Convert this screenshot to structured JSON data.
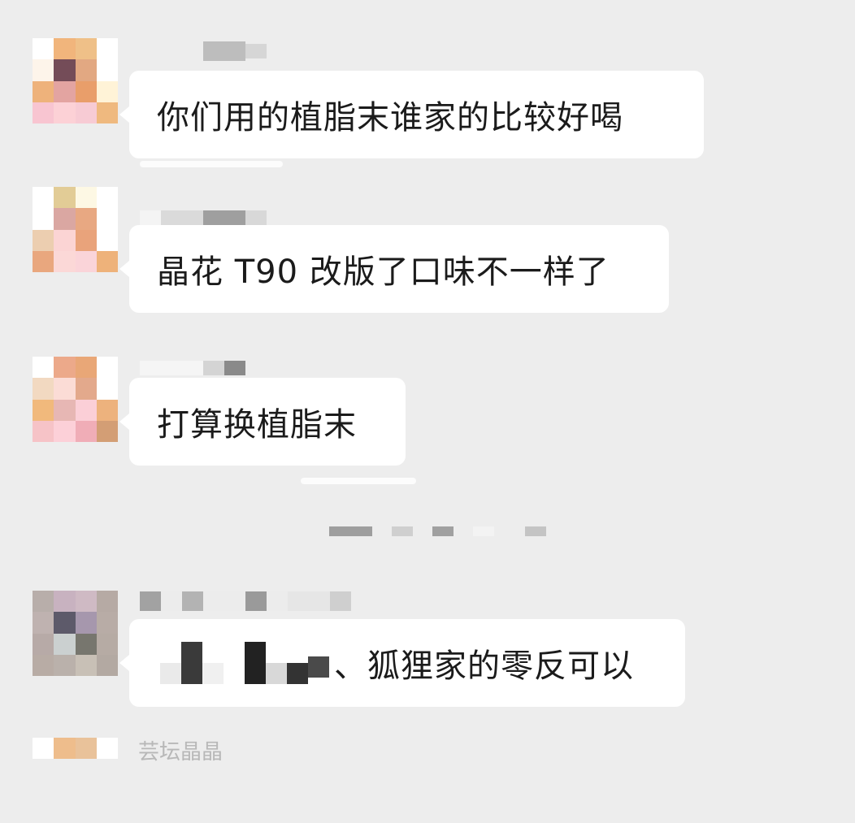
{
  "messages": [
    {
      "text": "你们用的植脂末谁家的比较好喝"
    },
    {
      "text": "晶花 T90 改版了口味不一样了"
    },
    {
      "text": "打算换植脂末"
    },
    {
      "text": "、狐狸家的零反可以"
    }
  ],
  "partial_name": "芸坛晶晶",
  "colors": {
    "background": "#ededed",
    "bubble": "#ffffff",
    "text": "#1b1b1b"
  }
}
